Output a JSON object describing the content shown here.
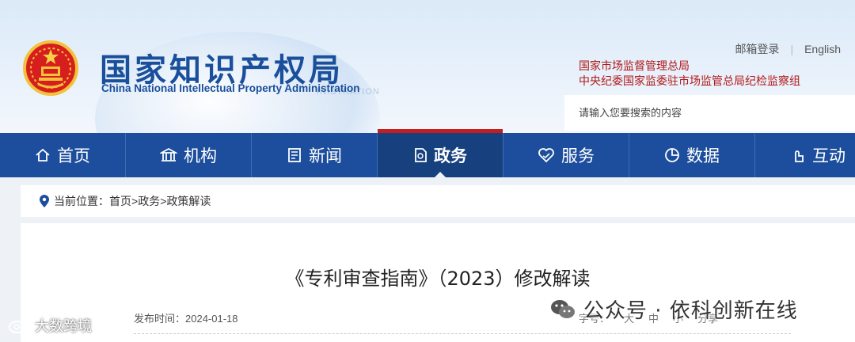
{
  "header": {
    "title_cn": "国家知识产权局",
    "title_en": "China National Intellectual Property Administration",
    "top_links": [
      "邮箱登录",
      "English"
    ],
    "related": [
      "国家市场监督管理总局",
      "中央纪委国家监委驻市场监管总局纪检监察组"
    ],
    "search_placeholder": "请输入您要搜索的内容"
  },
  "nav": {
    "items": [
      {
        "label": "首页",
        "icon": "home-icon"
      },
      {
        "label": "机构",
        "icon": "institution-icon"
      },
      {
        "label": "新闻",
        "icon": "news-icon"
      },
      {
        "label": "政务",
        "icon": "government-icon",
        "active": true
      },
      {
        "label": "服务",
        "icon": "service-icon"
      },
      {
        "label": "数据",
        "icon": "data-chart-icon"
      },
      {
        "label": "互动",
        "icon": "interaction-icon"
      }
    ]
  },
  "breadcrumb": {
    "prefix": "当前位置：",
    "items": [
      "首页",
      "政务",
      "政策解读"
    ],
    "separator": ">"
  },
  "article": {
    "title": "《专利审查指南》（2023）修改解读",
    "publish_label": "发布时间：",
    "publish_date": "2024-01-18",
    "font_size_label": "字号：",
    "font_sizes": [
      "大",
      "中",
      "小"
    ],
    "share_label": "分享"
  },
  "watermarks": {
    "right": "公众号 · 依科创新在线",
    "left": "大数跨境"
  },
  "colors": {
    "nav_bg": "#1c4e9d",
    "nav_active": "#17407f",
    "accent_red": "#c41e1e",
    "brand_blue": "#1a4f9c"
  }
}
